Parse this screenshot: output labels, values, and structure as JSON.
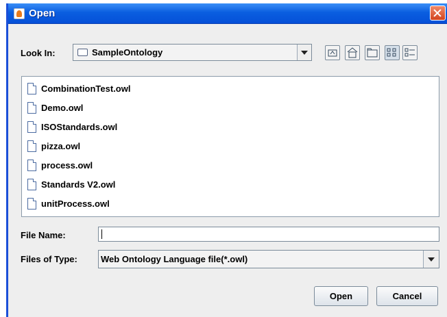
{
  "window": {
    "title": "Open"
  },
  "lookin": {
    "label": "Look In:",
    "value": "SampleOntology"
  },
  "files": [
    {
      "name": "CombinationTest.owl"
    },
    {
      "name": "Demo.owl"
    },
    {
      "name": "ISOStandards.owl"
    },
    {
      "name": "pizza.owl"
    },
    {
      "name": "process.owl"
    },
    {
      "name": "Standards V2.owl"
    },
    {
      "name": "unitProcess.owl"
    }
  ],
  "filename": {
    "label": "File Name:",
    "value": ""
  },
  "filetype": {
    "label": "Files of Type:",
    "value": "Web Ontology Language file(*.owl)"
  },
  "buttons": {
    "open": "Open",
    "cancel": "Cancel"
  },
  "toolbar": {
    "icons": [
      "up-one-level-icon",
      "home-icon",
      "new-folder-icon",
      "list-view-icon",
      "details-view-icon"
    ],
    "selected": "list-view-icon"
  },
  "colors": {
    "titlebar": "#0a5ee0",
    "close": "#d2441e",
    "dialog_bg": "#eeeeee"
  }
}
